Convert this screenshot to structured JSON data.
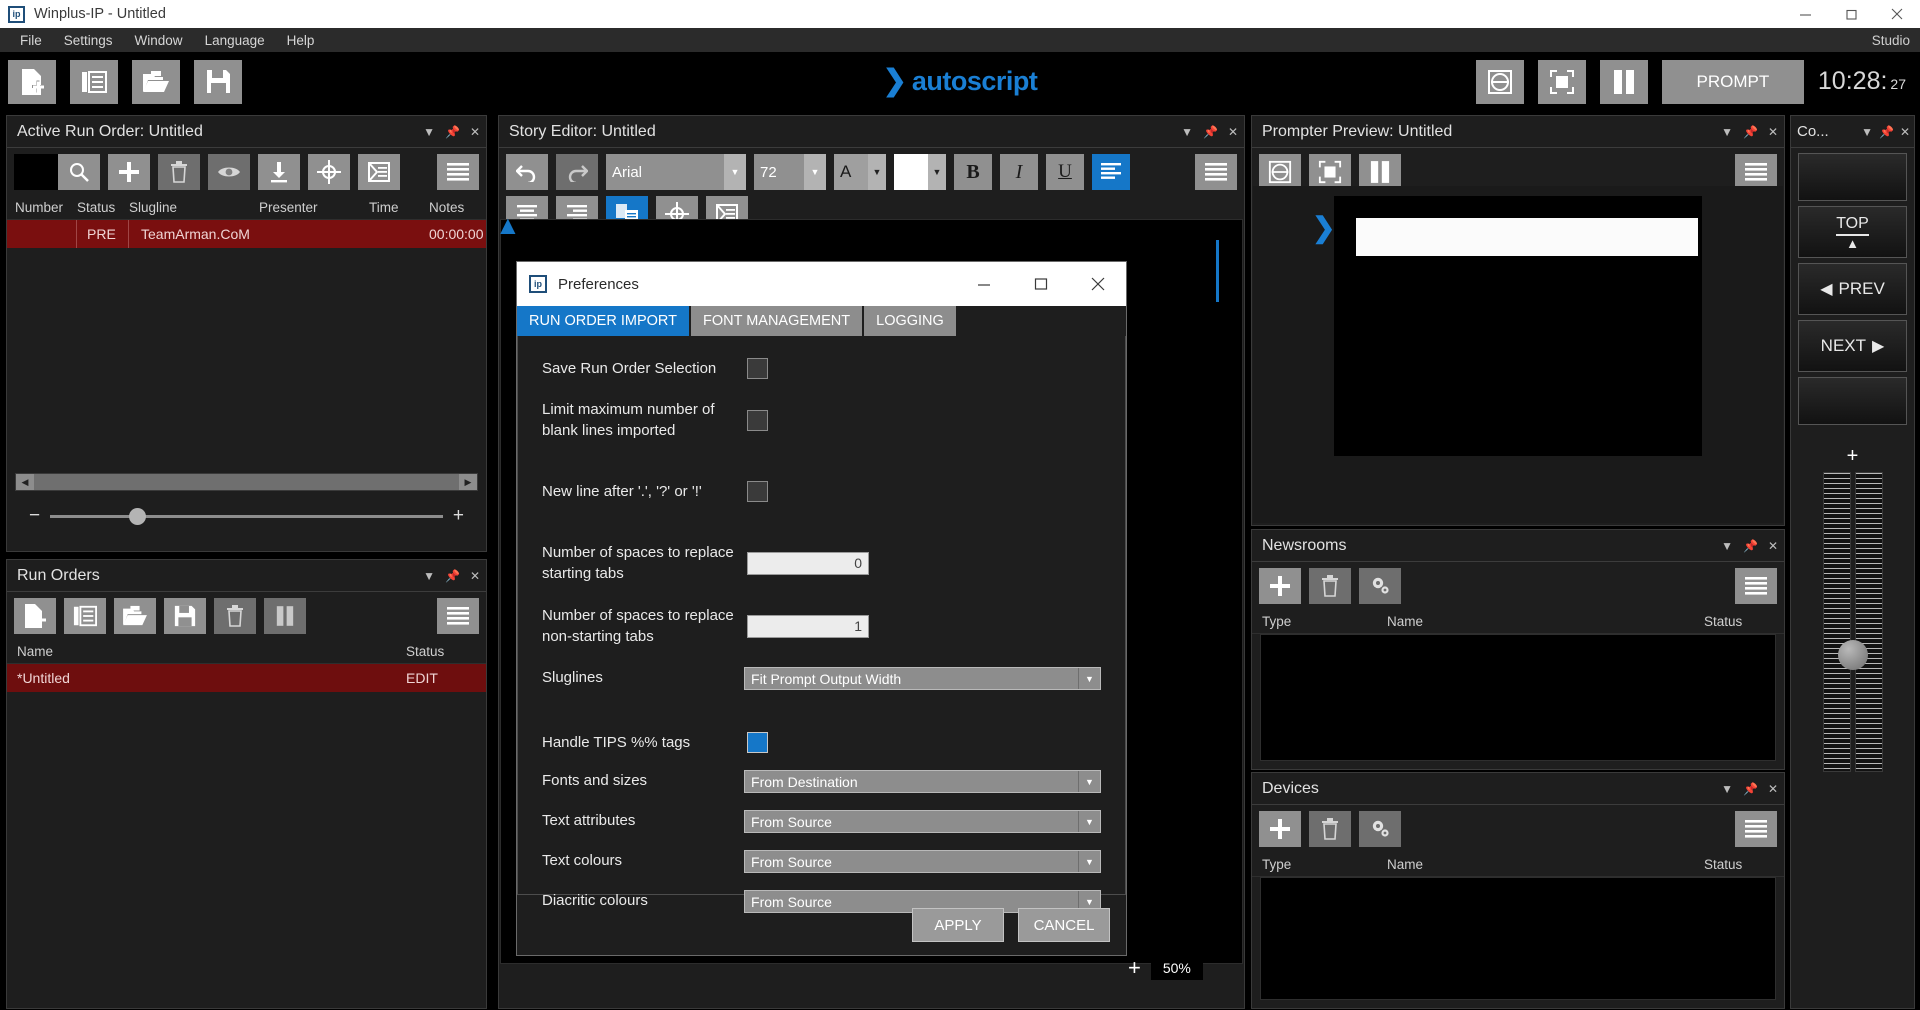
{
  "window": {
    "title": "Winplus-IP - Untitled",
    "logo_text": "ip",
    "minimize": "minimize-icon",
    "maximize": "maximize-icon",
    "close": "close-icon"
  },
  "menubar": {
    "items": [
      "File",
      "Settings",
      "Window",
      "Language",
      "Help"
    ],
    "right_label": "Studio"
  },
  "app_toolbar": {
    "left_buttons": [
      "new-story-icon",
      "run-order-icon",
      "open-folder-icon",
      "save-icon"
    ],
    "right_buttons": [
      "cue-marker-icon",
      "fullscreen-icon",
      "pause-icon"
    ],
    "prompt_label": "PROMPT",
    "clock_time": "10:28:",
    "clock_seconds": "27"
  },
  "brand": {
    "name": "autoscript",
    "chevron": "chevron-right-icon"
  },
  "active_run_order": {
    "title": "Active Run Order: Untitled",
    "toolbar": [
      "color-swatch",
      "search-icon",
      "add-icon",
      "delete-icon",
      "eye-icon",
      "download-icon",
      "target-icon",
      "script-icon",
      "menu-icon"
    ],
    "columns": [
      "Number",
      "Status",
      "Slugline",
      "Presenter",
      "Time",
      "Notes"
    ],
    "rows": [
      {
        "number": "",
        "status": "PRE",
        "slugline": "TeamArman.CoM",
        "presenter": "",
        "time": "00:00:00",
        "notes": ""
      }
    ]
  },
  "run_orders": {
    "title": "Run Orders",
    "toolbar": [
      "new-run-order-icon",
      "run-order-icon",
      "open-folder-icon",
      "save-icon",
      "delete-icon",
      "pause-icon",
      "menu-icon"
    ],
    "columns": [
      "Name",
      "Status"
    ],
    "rows": [
      {
        "name": "*Untitled",
        "status": "EDIT"
      }
    ]
  },
  "story_editor": {
    "title": "Story Editor: Untitled",
    "toolbar": {
      "undo": "undo-icon",
      "redo": "redo-icon",
      "font_family": "Arial",
      "font_size": "72",
      "text_color_icon": "A",
      "highlight_icon": "highlight-color",
      "bold": "B",
      "italic": "I",
      "underline": "U",
      "align_left": "align-left-icon",
      "menu": "menu-icon",
      "row2": [
        "align-center-icon",
        "align-right-icon",
        "paste-special-icon",
        "target-icon",
        "script-icon"
      ]
    }
  },
  "prompter_preview": {
    "title": "Prompter Preview: Untitled",
    "toolbar": [
      "cue-marker-icon",
      "fullscreen-icon",
      "pause-icon",
      "menu-icon"
    ],
    "cue_marker": "chevron-right-icon"
  },
  "newsrooms": {
    "title": "Newsrooms",
    "toolbar": [
      "add-icon",
      "delete-icon",
      "settings-gears-icon",
      "menu-icon"
    ],
    "columns": [
      "Type",
      "Name",
      "Status"
    ],
    "rows": []
  },
  "devices": {
    "title": "Devices",
    "toolbar": [
      "add-icon",
      "delete-icon",
      "settings-gears-icon",
      "menu-icon"
    ],
    "columns": [
      "Type",
      "Name",
      "Status"
    ],
    "rows": []
  },
  "controls_panel": {
    "title": "Co...",
    "buttons": [
      "",
      "TOP",
      "PREV",
      "NEXT",
      ""
    ],
    "top_label": "TOP",
    "prev_label": "PREV",
    "next_label": "NEXT",
    "plus_label": "+"
  },
  "zoom_widget": {
    "plus": "+",
    "percent": "50%"
  },
  "panel_chrome": {
    "collapse": "chevron-down-icon",
    "pin": "pin-icon",
    "close": "close-icon"
  },
  "preferences_dialog": {
    "title": "Preferences",
    "logo_text": "ip",
    "window_controls": [
      "minimize-icon",
      "maximize-icon",
      "close-icon"
    ],
    "tabs": [
      {
        "label": "RUN ORDER IMPORT",
        "active": true
      },
      {
        "label": "FONT MANAGEMENT",
        "active": false
      },
      {
        "label": "LOGGING",
        "active": false
      }
    ],
    "fields": [
      {
        "label": "Save Run Order Selection",
        "type": "checkbox",
        "value": false
      },
      {
        "label": "Limit maximum number of blank lines imported",
        "type": "checkbox",
        "value": false
      },
      {
        "label": "New line after '.', '?' or '!'",
        "type": "checkbox",
        "value": false
      },
      {
        "label": "Number of spaces to replace starting tabs",
        "type": "number",
        "value": "0"
      },
      {
        "label": "Number of spaces to replace non-starting tabs",
        "type": "number",
        "value": "1"
      },
      {
        "label": "Sluglines",
        "type": "select",
        "value": "Fit Prompt Output Width"
      },
      {
        "label": "Handle TIPS %% tags",
        "type": "checkbox",
        "value": true
      },
      {
        "label": "Fonts and sizes",
        "type": "select",
        "value": "From Destination"
      },
      {
        "label": "Text attributes",
        "type": "select",
        "value": "From Source"
      },
      {
        "label": "Text colours",
        "type": "select",
        "value": "From Source"
      },
      {
        "label": "Diacritic colours",
        "type": "select",
        "value": "From Source"
      }
    ],
    "apply_label": "APPLY",
    "cancel_label": "CANCEL"
  },
  "colors": {
    "accent_blue": "#1577c8",
    "brand_blue": "#1a7fd4",
    "row_red": "#7a0f0f",
    "panel_bg": "#1e1e1e",
    "toolbar_btn": "#909090"
  }
}
